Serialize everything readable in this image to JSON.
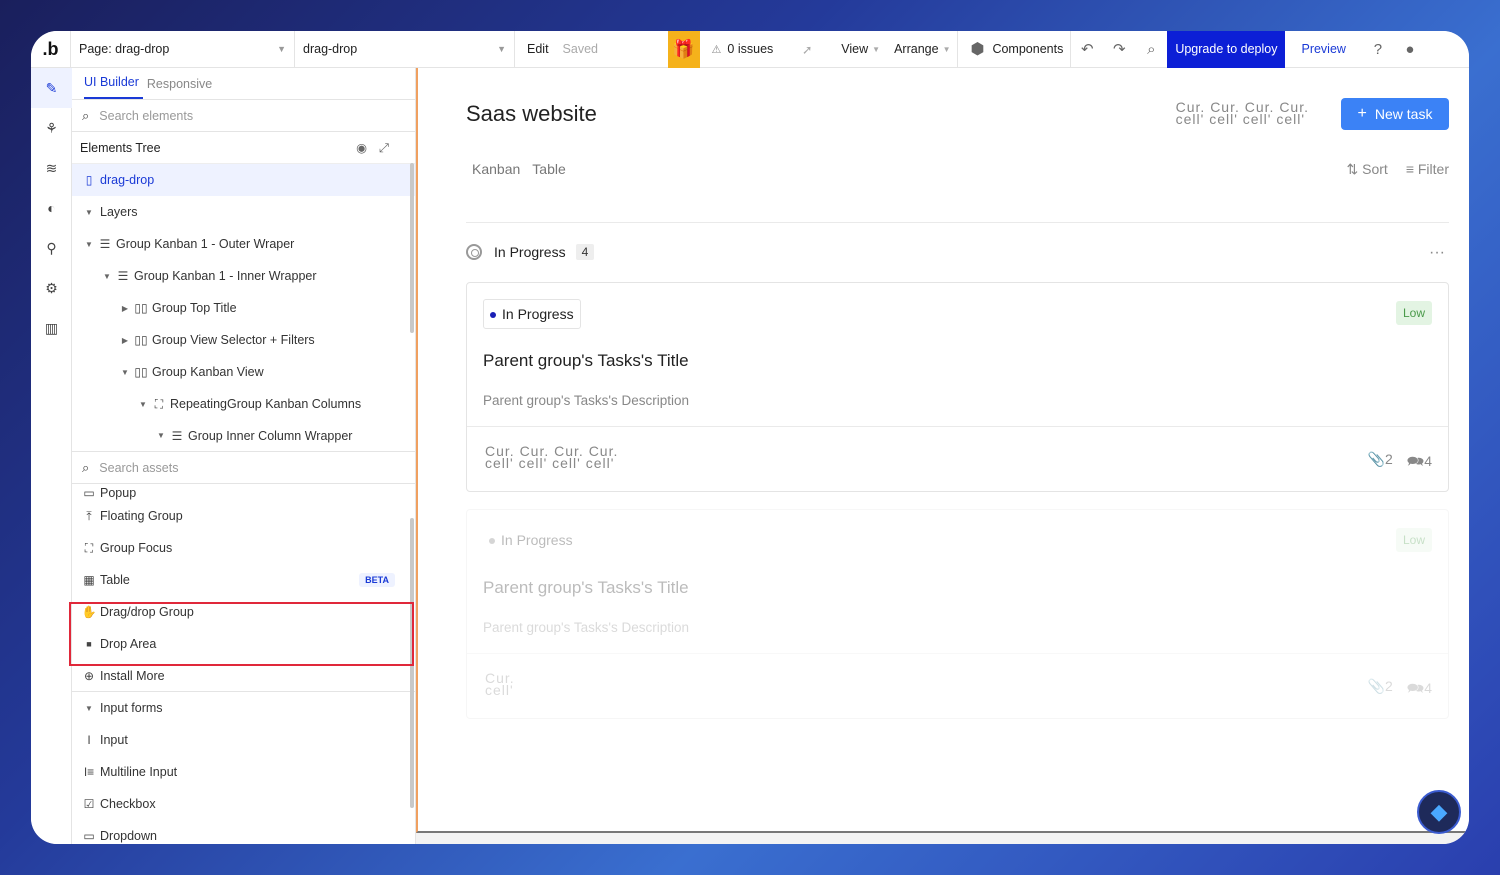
{
  "topbar": {
    "logo": ".b",
    "page_select": "Page: drag-drop",
    "element_select": "drag-drop",
    "edit": "Edit",
    "saved": "Saved",
    "issues": "0 issues",
    "view": "View",
    "arrange": "Arrange",
    "components": "Components",
    "upgrade": "Upgrade to deploy",
    "preview": "Preview"
  },
  "panel": {
    "tabs": [
      "UI Builder",
      "Responsive"
    ],
    "search_elements_placeholder": "Search elements",
    "elements_tree_label": "Elements Tree",
    "tree": [
      {
        "label": "drag-drop",
        "icon": "page-icon",
        "selected": true
      },
      {
        "label": "Layers",
        "icon": "",
        "bold": true
      },
      {
        "label": "Group Kanban 1 - Outer Wraper",
        "icon": "group-icon"
      },
      {
        "label": "Group Kanban 1 - Inner Wrapper",
        "icon": "group-icon"
      },
      {
        "label": "Group Top Title",
        "icon": "column-icon"
      },
      {
        "label": "Group View Selector + Filters",
        "icon": "column-icon"
      },
      {
        "label": "Group Kanban View",
        "icon": "column-icon"
      },
      {
        "label": "RepeatingGroup Kanban Columns",
        "icon": "repeating-group-icon"
      },
      {
        "label": "Group Inner Column Wrapper",
        "icon": "group-icon"
      }
    ],
    "search_assets_placeholder": "Search assets",
    "assets": [
      {
        "label": "Popup",
        "icon": "popup-icon"
      },
      {
        "label": "Floating Group",
        "icon": "floating-group-icon"
      },
      {
        "label": "Group Focus",
        "icon": "group-focus-icon"
      },
      {
        "label": "Table",
        "icon": "table-icon",
        "badge": "BETA"
      },
      {
        "label": "Drag/drop Group",
        "icon": "hand-icon"
      },
      {
        "label": "Drop Area",
        "icon": "drop-area-icon"
      },
      {
        "label": "Install More",
        "icon": "plus-circle-icon"
      }
    ],
    "input_forms_label": "Input forms",
    "input_forms": [
      {
        "label": "Input",
        "icon": "text-cursor-icon"
      },
      {
        "label": "Multiline Input",
        "icon": "multiline-icon"
      },
      {
        "label": "Checkbox",
        "icon": "checkbox-icon"
      },
      {
        "label": "Dropdown",
        "icon": "dropdown-icon"
      }
    ]
  },
  "canvas": {
    "title": "Saas website",
    "avatars_text": "Cur. Cur. Cur. Cur.",
    "avatars_text2": "cell' cell' cell' cell'",
    "new_task": "New task",
    "views": [
      "Kanban",
      "Table"
    ],
    "sort": "Sort",
    "filter": "Filter",
    "group_title": "In Progress",
    "group_count": "4",
    "cards": [
      {
        "status": "In Progress",
        "priority": "Low",
        "title": "Parent group's Tasks's Title",
        "description": "Parent group's Tasks's Description",
        "cur": "Cur. Cur. Cur. Cur.",
        "cell": "cell' cell' cell' cell'",
        "attachments": "2",
        "comments": "4"
      },
      {
        "status": "In Progress",
        "priority": "Low",
        "title": "Parent group's Tasks's Title",
        "description": "Parent group's Tasks's Description",
        "cur": "Cur.",
        "cell": "cell'",
        "attachments": "2",
        "comments": "4"
      }
    ]
  },
  "colors": {
    "accent": "#1a3ad6",
    "upgrade_bg": "#0c1fd6",
    "gift_bg": "#f5b21b",
    "highlight": "#e0283a",
    "new_task_bg": "#3b82f6"
  }
}
